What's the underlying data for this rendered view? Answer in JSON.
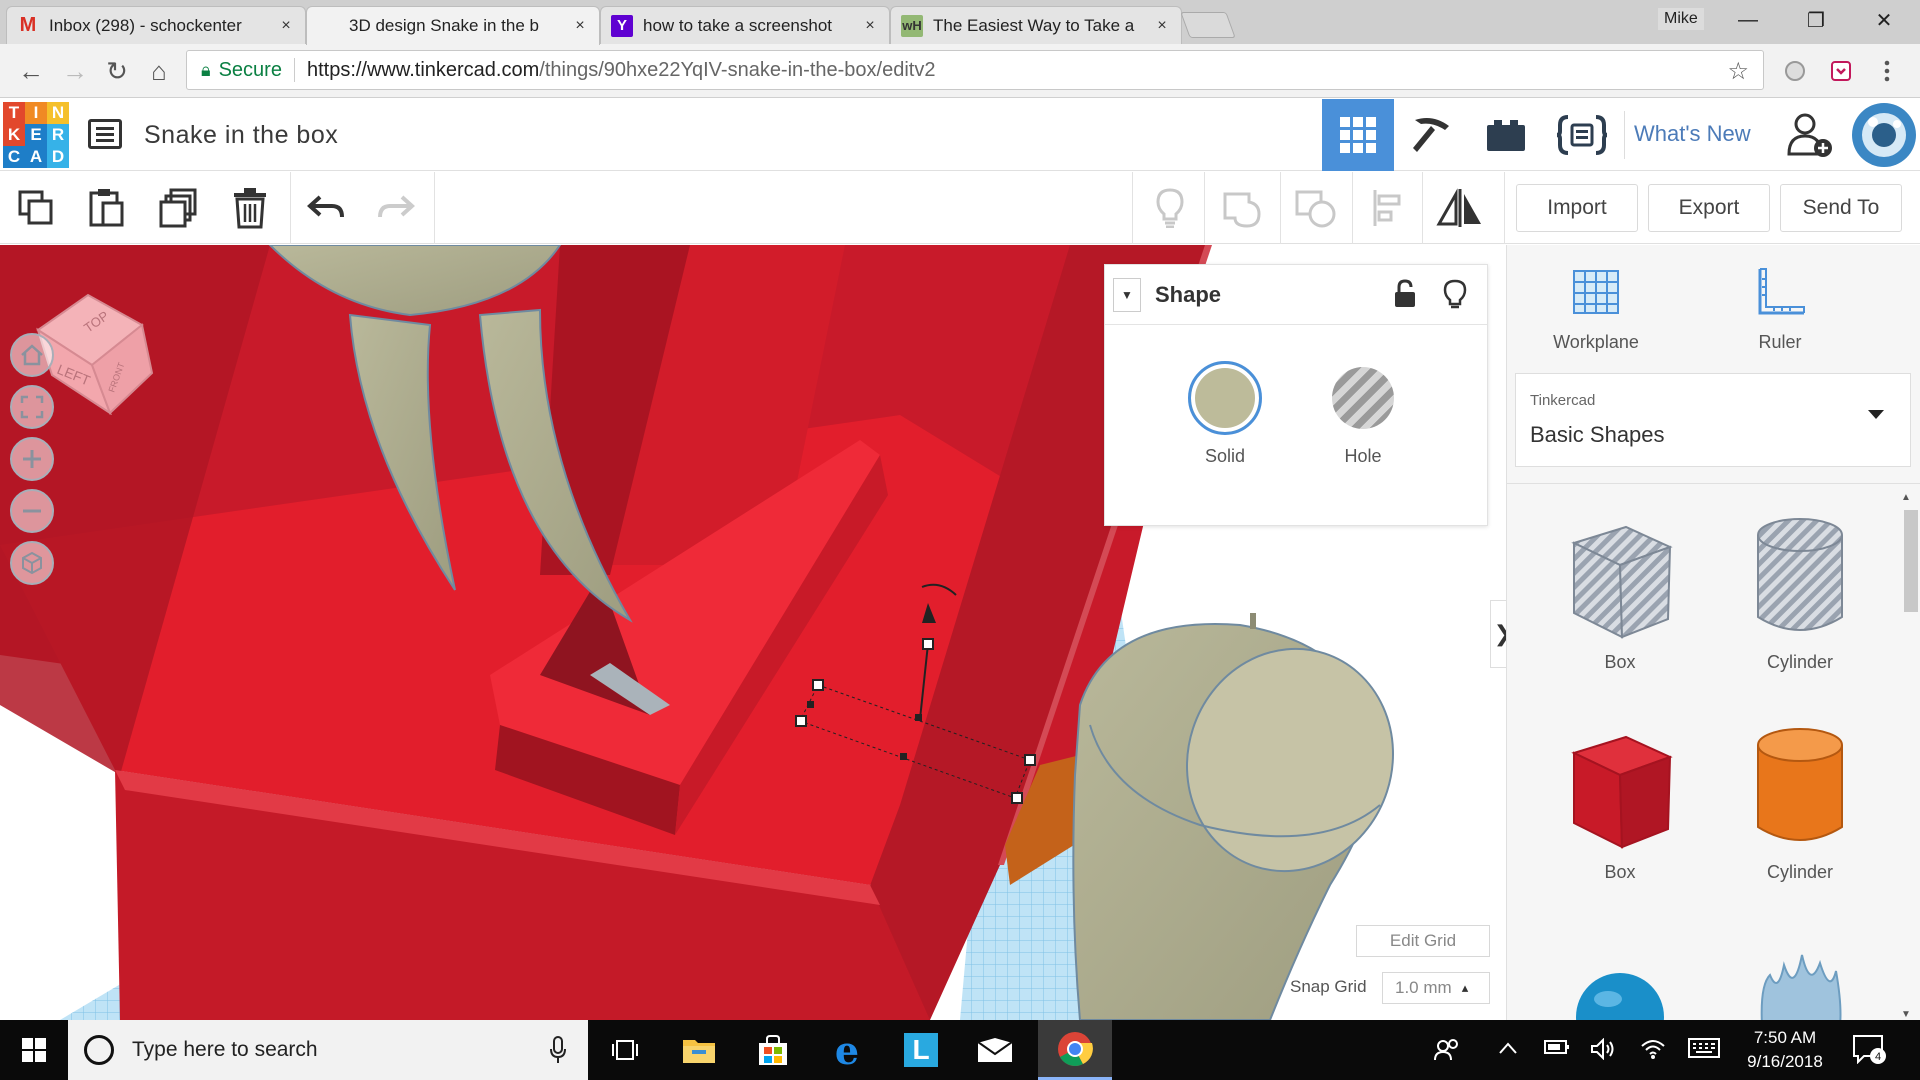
{
  "browser": {
    "tabs": [
      {
        "title": "Inbox (298) - schockenter",
        "favicon": "gmail-icon",
        "color": "#d93025"
      },
      {
        "title": "3D design Snake in the b",
        "favicon": "tinkercad-icon",
        "color": "#1f77b4"
      },
      {
        "title": "how to take a screenshot",
        "favicon": "yahoo-icon",
        "color": "#5f01d1"
      },
      {
        "title": "The Easiest Way to Take a",
        "favicon": "wikihow-icon",
        "color": "#93b874"
      }
    ],
    "tab_close": "×",
    "user": "Mike",
    "window_controls": {
      "minimize": "—",
      "restore": "❐",
      "close": "✕"
    },
    "address": {
      "secure_label": "Secure",
      "url_prefix": "https://www.tinkercad.com",
      "url_path": "/things/90hxe22YqIV-snake-in-the-box/editv2"
    }
  },
  "app": {
    "logo_letters": [
      "T",
      "I",
      "N",
      "K",
      "E",
      "R",
      "C",
      "A",
      "D"
    ],
    "logo_colors": [
      "#e2482c",
      "#f08a24",
      "#f5c02a",
      "#e2482c",
      "#1e7ec8",
      "#36b2e8",
      "#1e7ec8",
      "#1e7ec8",
      "#36b2e8"
    ],
    "design_title": "Snake in the box",
    "whats_new": "What's New",
    "accent": "#4a90d9"
  },
  "toolbar": {
    "import": "Import",
    "export": "Export",
    "send_to": "Send To"
  },
  "viewcube": {
    "top": "TOP",
    "left": "LEFT",
    "front": "FRONT"
  },
  "shape_panel": {
    "title": "Shape",
    "solid_label": "Solid",
    "hole_label": "Hole",
    "solid_color": "#bdbb9a"
  },
  "grid": {
    "edit_grid": "Edit Grid",
    "snap_label": "Snap Grid",
    "snap_value": "1.0 mm",
    "snap_caret": "▴"
  },
  "right_panel": {
    "workplane": "Workplane",
    "ruler": "Ruler",
    "library_small": "Tinkercad",
    "library_name": "Basic Shapes",
    "collapse": "❯",
    "shapes": [
      {
        "name": "Box",
        "kind": "box-hole"
      },
      {
        "name": "Cylinder",
        "kind": "cylinder-hole"
      },
      {
        "name": "Box",
        "kind": "box-solid",
        "color": "#d41f2a"
      },
      {
        "name": "Cylinder",
        "kind": "cylinder-solid",
        "color": "#e8761b"
      }
    ]
  },
  "taskbar": {
    "search_placeholder": "Type here to search",
    "time": "7:50 AM",
    "date": "9/16/2018",
    "notifications": "4"
  }
}
